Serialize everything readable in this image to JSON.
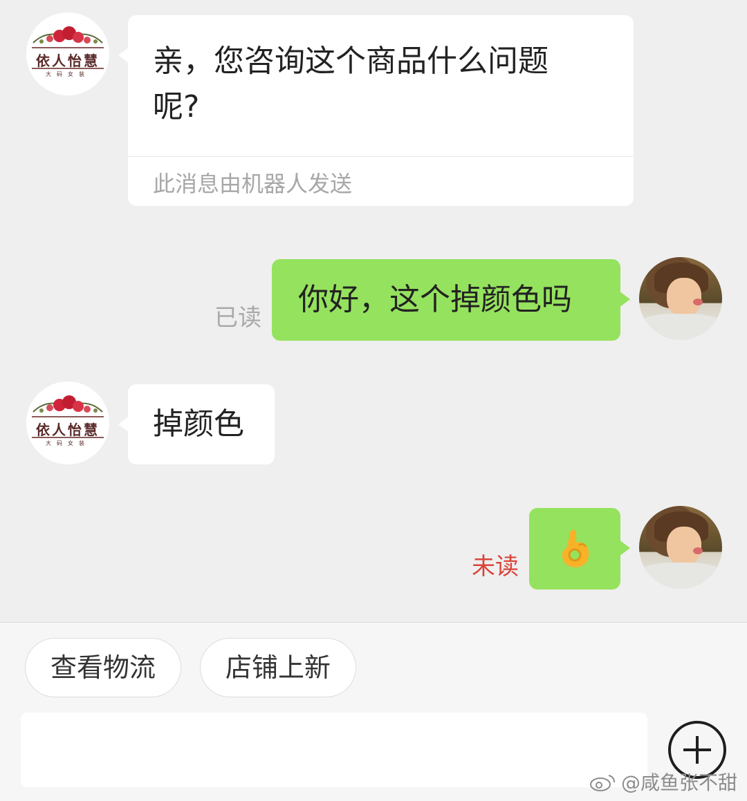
{
  "shop": {
    "avatar_brand": "依人怡慧",
    "avatar_subtitle": "大码女装"
  },
  "messages": [
    {
      "side": "in",
      "text_line1": "亲，您咨询这个商品什么问题",
      "text_line2": "呢?",
      "note": "此消息由机器人发送"
    },
    {
      "side": "out",
      "text": "你好，这个掉颜色吗",
      "status": "已读"
    },
    {
      "side": "in",
      "text": "掉颜色"
    },
    {
      "side": "out",
      "emoji": "ok-hand",
      "status": "未读"
    }
  ],
  "quick_actions": [
    "查看物流",
    "店铺上新"
  ],
  "input": {
    "placeholder": ""
  },
  "watermark": "@咸鱼张不甜",
  "colors": {
    "background": "#efefef",
    "incoming_bubble": "#ffffff",
    "outgoing_bubble": "#95e25e",
    "unread": "#d9453a",
    "read": "#a9a9a9"
  }
}
